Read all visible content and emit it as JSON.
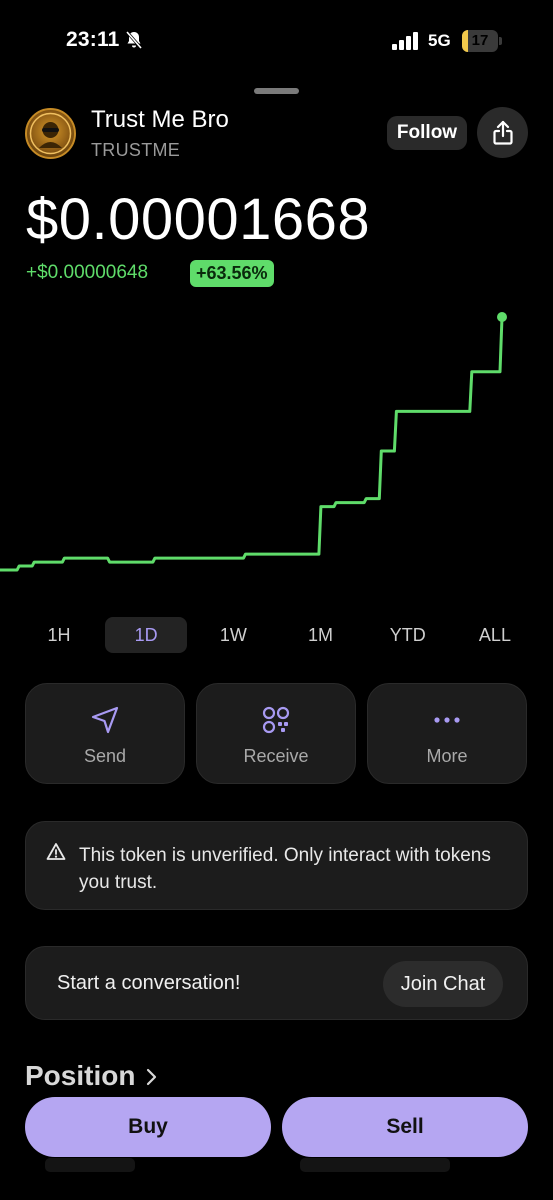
{
  "status_bar": {
    "time": "23:11",
    "network": "5G",
    "battery": "17",
    "battery_level": 0.17
  },
  "token": {
    "name": "Trust Me Bro",
    "symbol": "TRUSTME"
  },
  "header": {
    "follow_label": "Follow"
  },
  "price": {
    "value": "$0.00001668",
    "change_abs": "+$0.00000648",
    "change_pct": "+63.56%"
  },
  "chart_data": {
    "type": "line",
    "color": "#5fdc6a",
    "series": [
      {
        "values": [
          1.03,
          1.04,
          1.05,
          1.05,
          1.06,
          1.06,
          1.06,
          1.05,
          1.05,
          1.05,
          1.06,
          1.06,
          1.06,
          1.06,
          1.06,
          1.06,
          1.07,
          1.07,
          1.07,
          1.07,
          1.07,
          1.19,
          1.2,
          1.2,
          1.21,
          1.33,
          1.43,
          1.43,
          1.43,
          1.43,
          1.43,
          1.53,
          1.53,
          1.668
        ]
      }
    ]
  },
  "ranges": {
    "items": [
      "1H",
      "1D",
      "1W",
      "1M",
      "YTD",
      "ALL"
    ],
    "active": "1D"
  },
  "actions": {
    "send": "Send",
    "receive": "Receive",
    "more": "More"
  },
  "warning": {
    "text": "This token is unverified. Only interact with tokens you trust."
  },
  "chat": {
    "prompt": "Start a conversation!",
    "button": "Join Chat"
  },
  "position": {
    "title": "Position"
  },
  "trade": {
    "buy": "Buy",
    "sell": "Sell"
  }
}
